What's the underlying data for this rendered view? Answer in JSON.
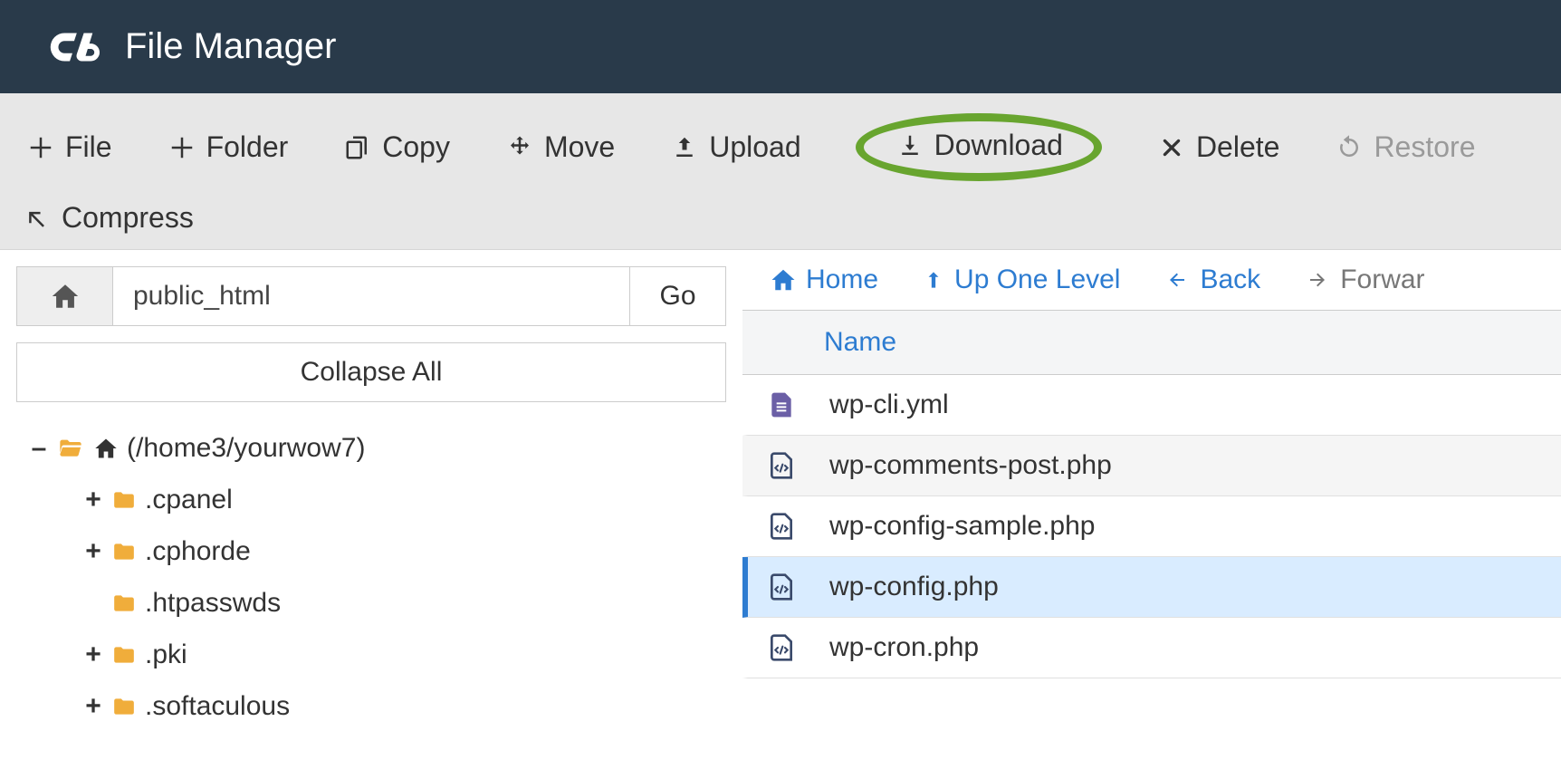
{
  "header": {
    "title": "File Manager"
  },
  "toolbar": {
    "file": "File",
    "folder": "Folder",
    "copy": "Copy",
    "move": "Move",
    "upload": "Upload",
    "download": "Download",
    "delete": "Delete",
    "restore": "Restore",
    "compress": "Compress",
    "highlighted": "download"
  },
  "pathbar": {
    "value": "public_html",
    "go": "Go"
  },
  "collapse_all": "Collapse All",
  "tree": {
    "root_label": "(/home3/yourwow7)",
    "items": [
      {
        "label": ".cpanel",
        "toggle": "+"
      },
      {
        "label": ".cphorde",
        "toggle": "+"
      },
      {
        "label": ".htpasswds",
        "toggle": null
      },
      {
        "label": ".pki",
        "toggle": "+"
      },
      {
        "label": ".softaculous",
        "toggle": "+"
      }
    ]
  },
  "nav": {
    "home": "Home",
    "up": "Up One Level",
    "back": "Back",
    "forward": "Forwar"
  },
  "table": {
    "column": "Name",
    "rows": [
      {
        "name": "wp-cli.yml",
        "icon": "doc",
        "selected": false
      },
      {
        "name": "wp-comments-post.php",
        "icon": "code",
        "selected": false
      },
      {
        "name": "wp-config-sample.php",
        "icon": "code",
        "selected": false
      },
      {
        "name": "wp-config.php",
        "icon": "code",
        "selected": true
      },
      {
        "name": "wp-cron.php",
        "icon": "code",
        "selected": false
      }
    ]
  },
  "colors": {
    "accent": "#2d7cd1",
    "header": "#293a4a",
    "highlight": "#68a52f",
    "folder": "#f0ad3b"
  }
}
